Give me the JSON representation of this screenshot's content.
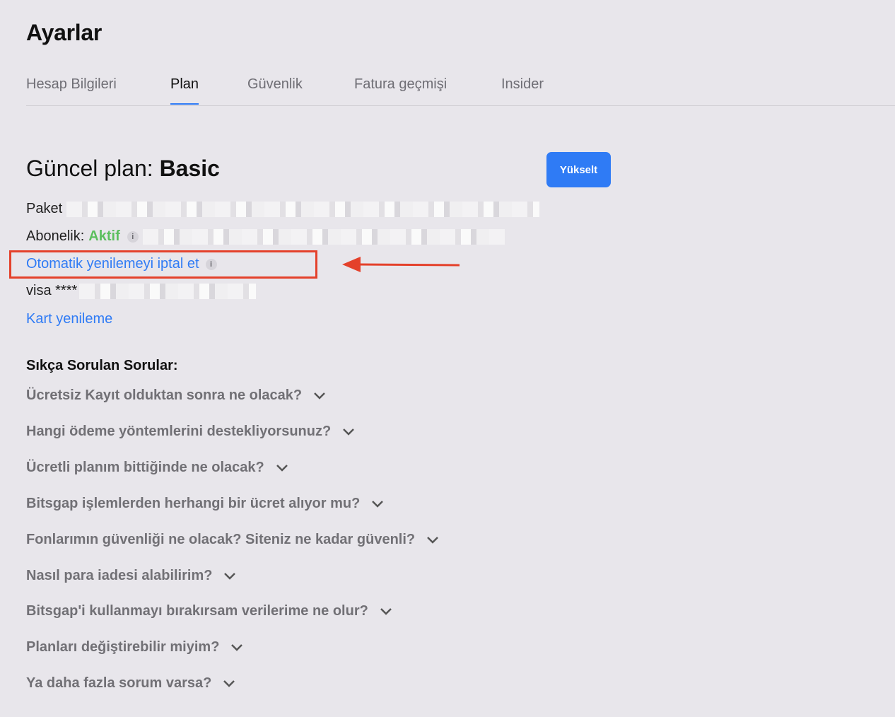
{
  "page": {
    "title": "Ayarlar"
  },
  "tabs": [
    {
      "label": "Hesap Bilgileri",
      "active": false
    },
    {
      "label": "Plan",
      "active": true
    },
    {
      "label": "Güvenlik",
      "active": false
    },
    {
      "label": "Fatura geçmişi",
      "active": false
    },
    {
      "label": "Insider",
      "active": false
    }
  ],
  "plan": {
    "heading_prefix": "Güncel plan:",
    "plan_name": "Basic",
    "upgrade_label": "Yükselt",
    "package_label": "Paket",
    "subscription_label": "Abonelik:",
    "subscription_status": "Aktif",
    "cancel_renewal_label": "Otomatik yenilemeyi iptal et",
    "card_label": "visa ****",
    "card_renew_label": "Kart yenileme",
    "info_glyph": "i"
  },
  "faq": {
    "title": "Sıkça Sorulan Sorular:",
    "items": [
      "Ücretsiz Kayıt olduktan sonra ne olacak?",
      "Hangi ödeme yöntemlerini destekliyorsunuz?",
      "Ücretli planım bittiğinde ne olacak?",
      "Bitsgap işlemlerden herhangi bir ücret alıyor mu?",
      "Fonlarımın güvenliği ne olacak? Siteniz ne kadar güvenli?",
      "Nasıl para iadesi alabilirim?",
      "Bitsgap'i kullanmayı bırakırsam verilerime ne olur?",
      "Planları değiştirebilir miyim?",
      "Ya daha fazla sorum varsa?"
    ]
  },
  "colors": {
    "accent": "#2f7bf5",
    "active_status": "#5cbf5e",
    "annotation": "#e4412b",
    "background": "#e8e6eb"
  }
}
